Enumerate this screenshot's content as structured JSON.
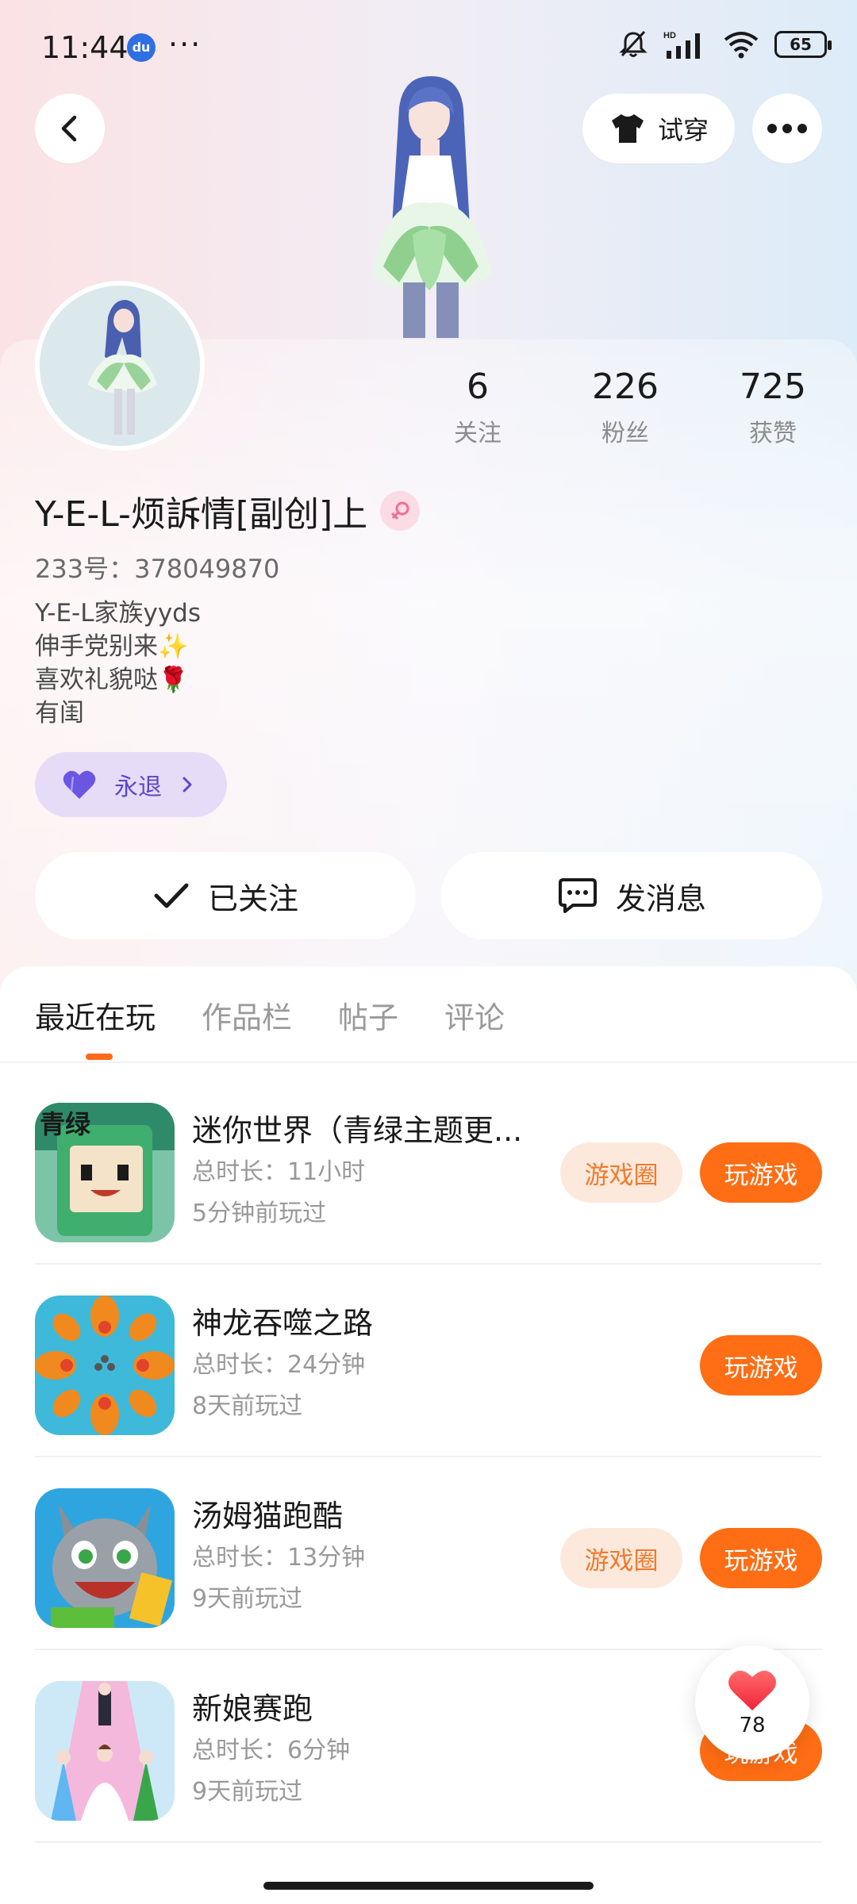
{
  "status_bar": {
    "time": "11:44",
    "more_indicator": "···",
    "battery": "65",
    "icons": [
      "baidu-notification-icon",
      "mute-bell-icon",
      "hd-signal-icon",
      "wifi-icon",
      "battery-icon"
    ]
  },
  "header": {
    "try_on_label": "试穿"
  },
  "profile": {
    "stats": [
      {
        "value": "6",
        "label": "关注"
      },
      {
        "value": "226",
        "label": "粉丝"
      },
      {
        "value": "725",
        "label": "获赞"
      }
    ],
    "username": "Y-E-L-烦訴情[副创]上",
    "uid": "233号：378049870",
    "bio": [
      "Y-E-L家族yyds",
      "伸手党别来✨",
      "喜欢礼貌哒🌹",
      "有闺"
    ],
    "badge_label": "永退",
    "follow_label": "已关注",
    "message_label": "发消息"
  },
  "tabs": [
    "最近在玩",
    "作品栏",
    "帖子",
    "评论"
  ],
  "games": [
    {
      "title": "迷你世界（青绿主题更...",
      "duration": "总时长：11小时",
      "last_played": "5分钟前玩过",
      "circle_label": "游戏圈",
      "play_label": "玩游戏",
      "icon_text": "青绿"
    },
    {
      "title": "神龙吞噬之路",
      "duration": "总时长：24分钟",
      "last_played": "8天前玩过",
      "play_label": "玩游戏"
    },
    {
      "title": "汤姆猫跑酷",
      "duration": "总时长：13分钟",
      "last_played": "9天前玩过",
      "circle_label": "游戏圈",
      "play_label": "玩游戏"
    },
    {
      "title": "新娘赛跑",
      "duration": "总时长：6分钟",
      "last_played": "9天前玩过",
      "play_label": "玩游戏"
    }
  ],
  "like_fab": {
    "count": "78"
  },
  "colors": {
    "accent": "#ff6d14",
    "circle_bg": "#fde9dc",
    "badge_bg": "#e6dcf8",
    "badge_text": "#5b47c9"
  }
}
